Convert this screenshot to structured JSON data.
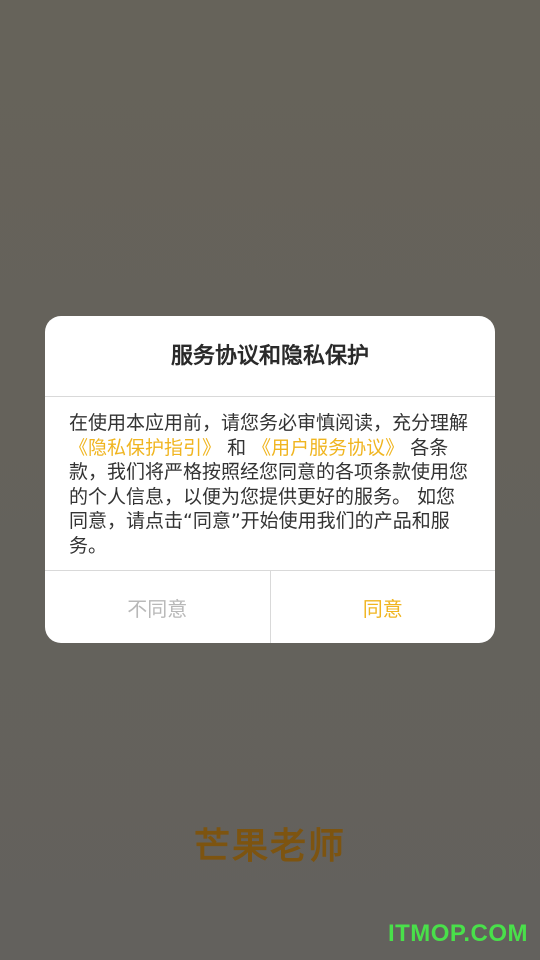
{
  "app": {
    "logo_text": "芒果老师",
    "watermark": "ITMOP.COM"
  },
  "dialog": {
    "title": "服务协议和隐私保护",
    "body": {
      "text_1": "在使用本应用前，请您务必审慎阅读，充分理解",
      "link_privacy": "《隐私保护指引》",
      "text_2": "和",
      "link_service": "《用户服务协议》",
      "text_3": "各条款，我们将严格按照经您同意的各项条款使用您的个人信息，以便为您提供更好的服务。 如您同意，请点击“同意”开始使用我们的产品和服务。"
    },
    "buttons": {
      "disagree": "不同意",
      "agree": "同意"
    }
  },
  "colors": {
    "accent": "#f0b520",
    "backdrop": "#66635a",
    "logo": "#7d5410",
    "watermark": "#49e04a"
  }
}
